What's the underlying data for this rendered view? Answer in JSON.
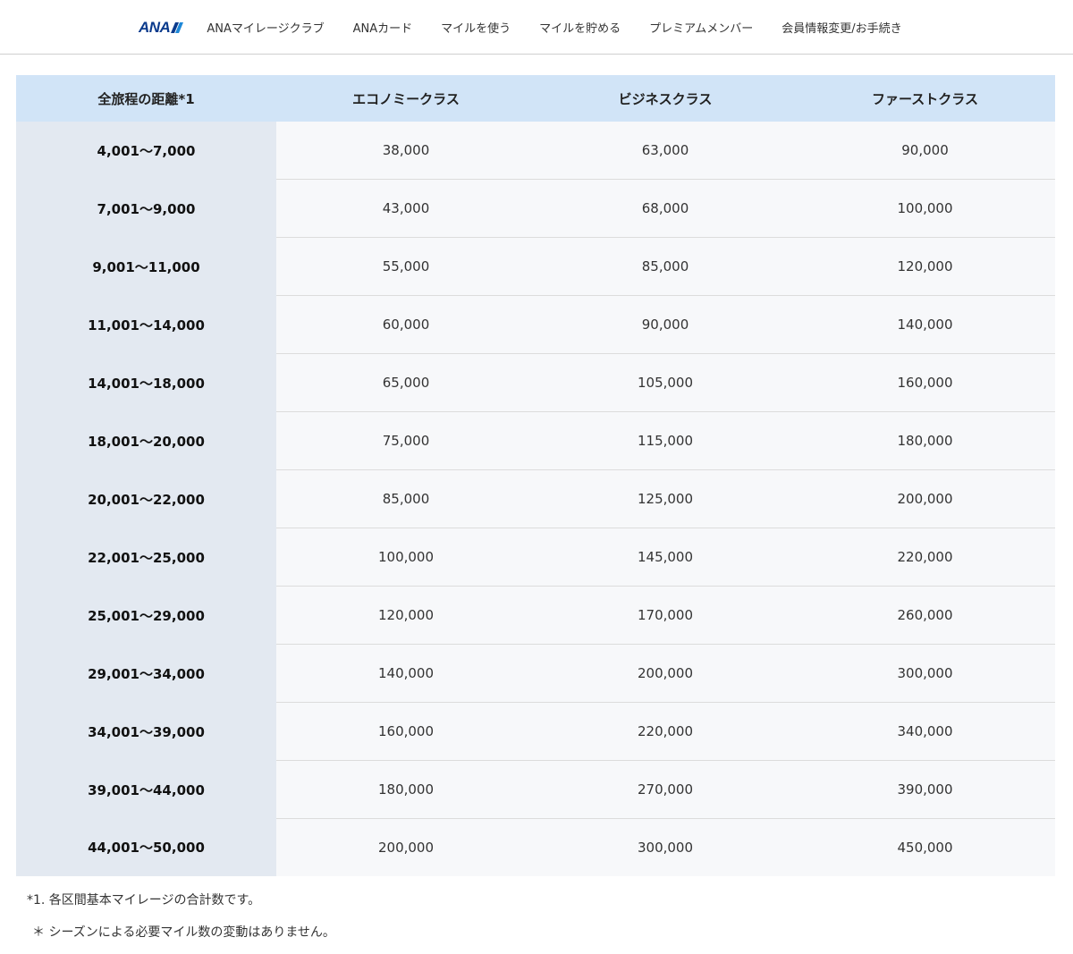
{
  "header": {
    "logo_text": "ANA",
    "nav": [
      "ANAマイレージクラブ",
      "ANAカード",
      "マイルを使う",
      "マイルを貯める",
      "プレミアムメンバー",
      "会員情報変更/お手続き"
    ]
  },
  "table": {
    "headers": [
      "全旅程の距離*1",
      "エコノミークラス",
      "ビジネスクラス",
      "ファーストクラス"
    ],
    "rows": [
      [
        "4,001～7,000",
        "38,000",
        "63,000",
        "90,000"
      ],
      [
        "7,001～9,000",
        "43,000",
        "68,000",
        "100,000"
      ],
      [
        "9,001～11,000",
        "55,000",
        "85,000",
        "120,000"
      ],
      [
        "11,001～14,000",
        "60,000",
        "90,000",
        "140,000"
      ],
      [
        "14,001～18,000",
        "65,000",
        "105,000",
        "160,000"
      ],
      [
        "18,001～20,000",
        "75,000",
        "115,000",
        "180,000"
      ],
      [
        "20,001～22,000",
        "85,000",
        "125,000",
        "200,000"
      ],
      [
        "22,001～25,000",
        "100,000",
        "145,000",
        "220,000"
      ],
      [
        "25,001～29,000",
        "120,000",
        "170,000",
        "260,000"
      ],
      [
        "29,001～34,000",
        "140,000",
        "200,000",
        "300,000"
      ],
      [
        "34,001～39,000",
        "160,000",
        "220,000",
        "340,000"
      ],
      [
        "39,001～44,000",
        "180,000",
        "270,000",
        "390,000"
      ],
      [
        "44,001～50,000",
        "200,000",
        "300,000",
        "450,000"
      ]
    ]
  },
  "notes": {
    "note1": "*1. 各区間基本マイレージの合計数です。",
    "note2": "＊ シーズンによる必要マイル数の変動はありません。"
  },
  "colors": {
    "header_bg": "#d1e4f7",
    "distance_col_bg": "#e3e9f1",
    "cell_bg": "#f7f8fa",
    "logo_blue": "#0a3a8c"
  }
}
